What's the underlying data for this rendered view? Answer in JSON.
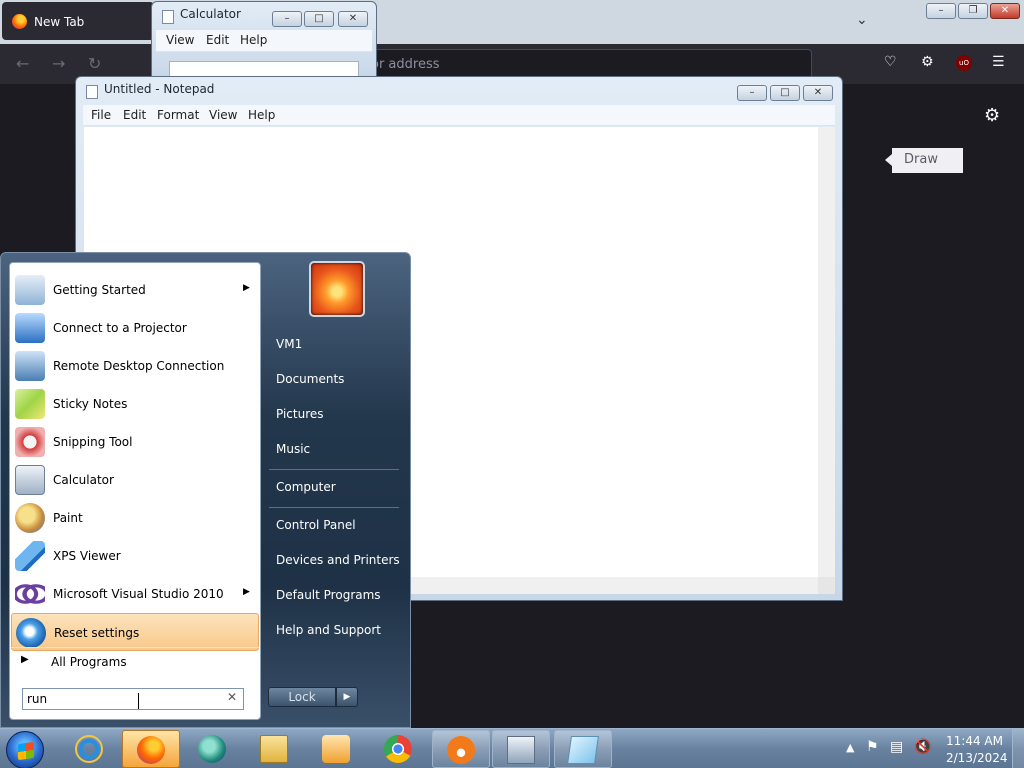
{
  "firefox": {
    "tab_title": "New Tab",
    "url_placeholder": "or address",
    "draw_tooltip": "Draw",
    "ublock_label": "uO"
  },
  "calculator": {
    "title": "Calculator",
    "menu": [
      "View",
      "Edit",
      "Help"
    ]
  },
  "notepad": {
    "title": "Untitled - Notepad",
    "menu": [
      "File",
      "Edit",
      "Format",
      "View",
      "Help"
    ]
  },
  "start_menu": {
    "programs": [
      {
        "label": "Getting Started",
        "icon": "getting-started-icon",
        "has_submenu": true
      },
      {
        "label": "Connect to a Projector",
        "icon": "projector-icon",
        "has_submenu": false
      },
      {
        "label": "Remote Desktop Connection",
        "icon": "remote-desktop-icon",
        "has_submenu": false
      },
      {
        "label": "Sticky Notes",
        "icon": "sticky-notes-icon",
        "has_submenu": false
      },
      {
        "label": "Snipping Tool",
        "icon": "scissors-icon",
        "has_submenu": false
      },
      {
        "label": "Calculator",
        "icon": "calculator-icon",
        "has_submenu": false
      },
      {
        "label": "Paint",
        "icon": "paint-palette-icon",
        "has_submenu": false
      },
      {
        "label": "XPS Viewer",
        "icon": "xps-viewer-icon",
        "has_submenu": false
      },
      {
        "label": "Microsoft Visual Studio 2010",
        "icon": "visual-studio-icon",
        "has_submenu": true
      },
      {
        "label": "Reset settings",
        "icon": "reset-settings-icon",
        "has_submenu": false,
        "highlighted": true
      }
    ],
    "all_programs": "All Programs",
    "search_value": "run",
    "right": {
      "user": "VM1",
      "documents": "Documents",
      "pictures": "Pictures",
      "music": "Music",
      "computer": "Computer",
      "control_panel": "Control Panel",
      "devices": "Devices and Printers",
      "default_programs": "Default Programs",
      "help": "Help and Support"
    },
    "lock_label": "Lock"
  },
  "taskbar": {
    "buttons": [
      {
        "name": "internet-explorer-icon",
        "state": "pinned"
      },
      {
        "name": "firefox-icon",
        "state": "active"
      },
      {
        "name": "app-globe-icon",
        "state": "pinned"
      },
      {
        "name": "file-explorer-icon",
        "state": "pinned"
      },
      {
        "name": "media-player-icon",
        "state": "pinned"
      },
      {
        "name": "chrome-icon",
        "state": "pinned"
      },
      {
        "name": "app-orange-icon",
        "state": "open"
      },
      {
        "name": "calculator-icon",
        "state": "open"
      },
      {
        "name": "notepad-icon",
        "state": "open"
      }
    ],
    "time": "11:44 AM",
    "date": "2/13/2024"
  },
  "colors": {
    "highlight": "#f8c88a",
    "firefox_dark": "#2b2a33",
    "taskbar": "#6882a0"
  }
}
